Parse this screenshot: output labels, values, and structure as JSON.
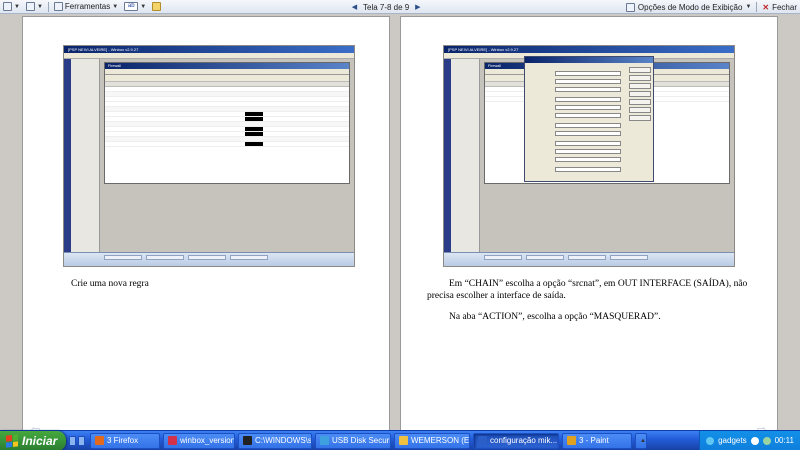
{
  "toolbar": {
    "tools_label": "Ferramentas",
    "page_indicator": "Tela 7-8 de 9",
    "view_options_label": "Opções de Modo de Exibição",
    "close_label": "Fechar"
  },
  "left_page": {
    "caption": "Crie uma nova regra"
  },
  "right_page": {
    "caption_line1": "Em “CHAIN” escolha a opção “srcnat”, em OUT INTERFACE (SAÍDA), não",
    "caption_line2": "precisa escolher a interface de saída.",
    "caption_line3": "Na aba “ACTION”, escolha a opção “MASQUERAD”."
  },
  "taskbar": {
    "start_label": "Iniciar",
    "tasks": [
      {
        "label": "3 Firefox",
        "icon_color": "#e36a1c"
      },
      {
        "label": "winbox_version_...",
        "icon_color": "#d2334a"
      },
      {
        "label": "C:\\WINDOWS\\sy...",
        "icon_color": "#222222"
      },
      {
        "label": "USB Disk Security...",
        "icon_color": "#3fa0e0"
      },
      {
        "label": "WEMERSON (E:)",
        "icon_color": "#f0c040"
      },
      {
        "label": "configuração mik...",
        "icon_color": "#2b5fc7"
      },
      {
        "label": "3 - Paint",
        "icon_color": "#e0a020"
      }
    ],
    "gadgets_label": "gadgets",
    "clock": "00:11"
  },
  "screenshot_text": {
    "winbox_title": "[PSP NEIVI ALVEIRE] - Winbox v2.9.27",
    "firewall_title": "Firewall",
    "nat_title": "NAT Rule"
  },
  "colors": {
    "xp_blue": "#245edb",
    "start_green": "#37943a",
    "reading_bg": "#ccc8c4"
  }
}
